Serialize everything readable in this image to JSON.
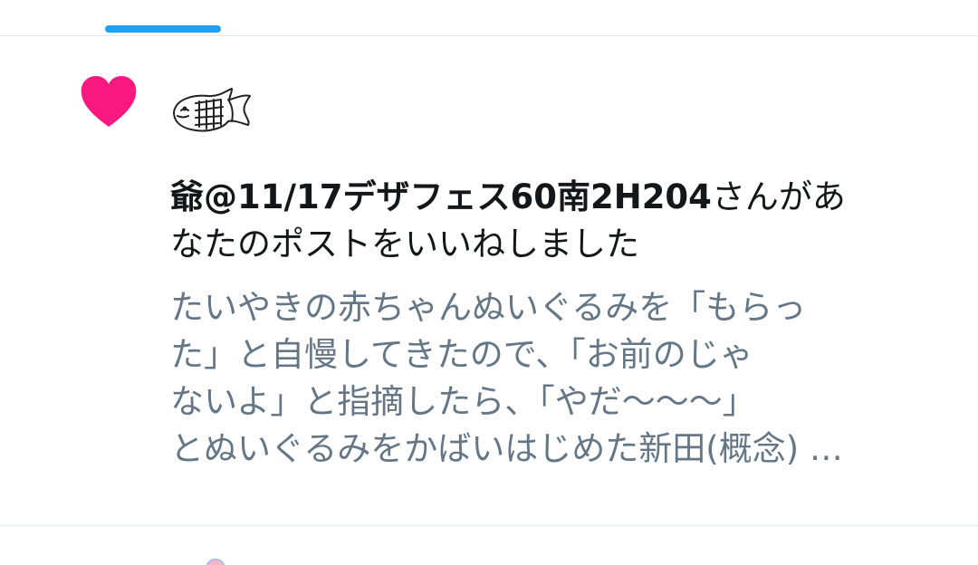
{
  "notification": {
    "user_name": "爺@11/17デザフェス60南2H204",
    "action_line1_suffix": "さんがあ",
    "action_line2": "なたのポストをいいねしました",
    "tweet_lines": [
      "たいやきの赤ちゃんぬいぐるみを「もらっ",
      "た」と自慢してきたので、「お前のじゃ",
      "ないよ」と指摘したら、「やだ〜〜〜」",
      "とぬいぐるみをかばいはじめた新田(概念) …"
    ],
    "icon": "heart-icon",
    "avatar": "taiyaki-sketch-avatar"
  },
  "colors": {
    "accent": "#1da1f2",
    "heart": "#f91880",
    "primary_text": "#14171a",
    "secondary_text": "#657786",
    "divider": "#e1e8ed"
  }
}
